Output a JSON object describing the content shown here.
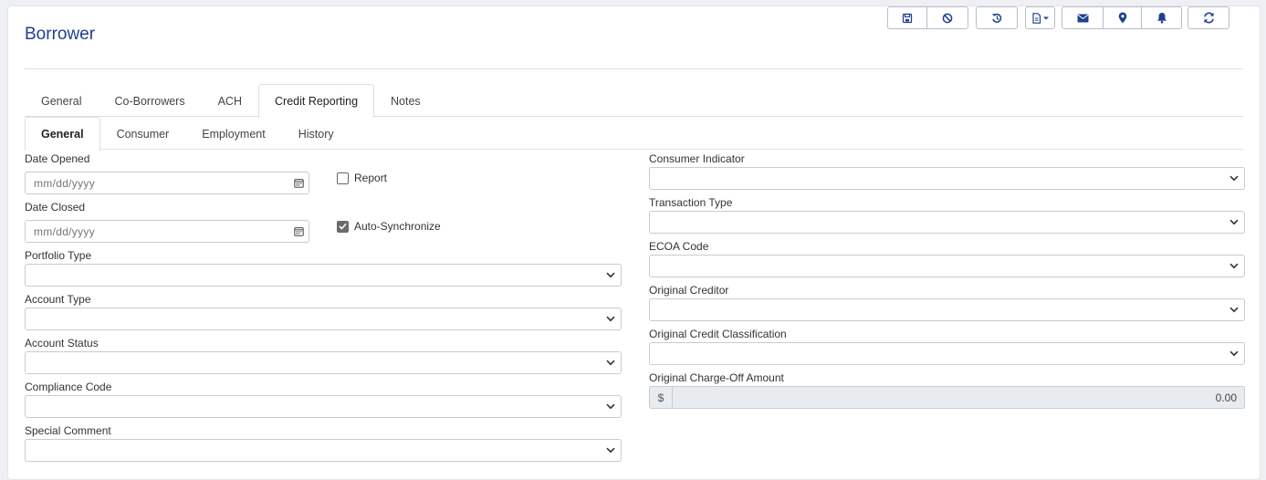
{
  "page": {
    "title": "Borrower"
  },
  "toolbar": {
    "icons": [
      "save-icon",
      "cancel-icon",
      "history-icon",
      "document-icon",
      "envelope-icon",
      "map-pin-icon",
      "bell-icon",
      "refresh-icon"
    ]
  },
  "tabs": {
    "main": [
      "General",
      "Co-Borrowers",
      "ACH",
      "Credit Reporting",
      "Notes"
    ],
    "main_active": "Credit Reporting",
    "sub": [
      "General",
      "Consumer",
      "Employment",
      "History"
    ],
    "sub_active": "General"
  },
  "form": {
    "date_opened": {
      "label": "Date Opened",
      "placeholder": "mm/dd/yyyy"
    },
    "date_closed": {
      "label": "Date Closed",
      "placeholder": "mm/dd/yyyy"
    },
    "report": {
      "label": "Report",
      "checked": false
    },
    "auto_sync": {
      "label": "Auto-Synchronize",
      "checked": true
    },
    "portfolio_type": {
      "label": "Portfolio Type",
      "value": ""
    },
    "account_type": {
      "label": "Account Type",
      "value": ""
    },
    "account_status": {
      "label": "Account Status",
      "value": ""
    },
    "compliance_code": {
      "label": "Compliance Code",
      "value": ""
    },
    "special_comment": {
      "label": "Special Comment",
      "value": ""
    },
    "consumer_indicator": {
      "label": "Consumer Indicator",
      "value": ""
    },
    "transaction_type": {
      "label": "Transaction Type",
      "value": ""
    },
    "ecoa_code": {
      "label": "ECOA Code",
      "value": ""
    },
    "original_creditor": {
      "label": "Original Creditor",
      "value": ""
    },
    "original_credit_classification": {
      "label": "Original Credit Classification",
      "value": ""
    },
    "original_charge_off_amount": {
      "label": "Original Charge-Off Amount",
      "currency": "$",
      "value": "0.00"
    }
  },
  "colors": {
    "title": "#1f3f8f",
    "icon": "#1f3f8f",
    "border": "#c7ccd3"
  }
}
